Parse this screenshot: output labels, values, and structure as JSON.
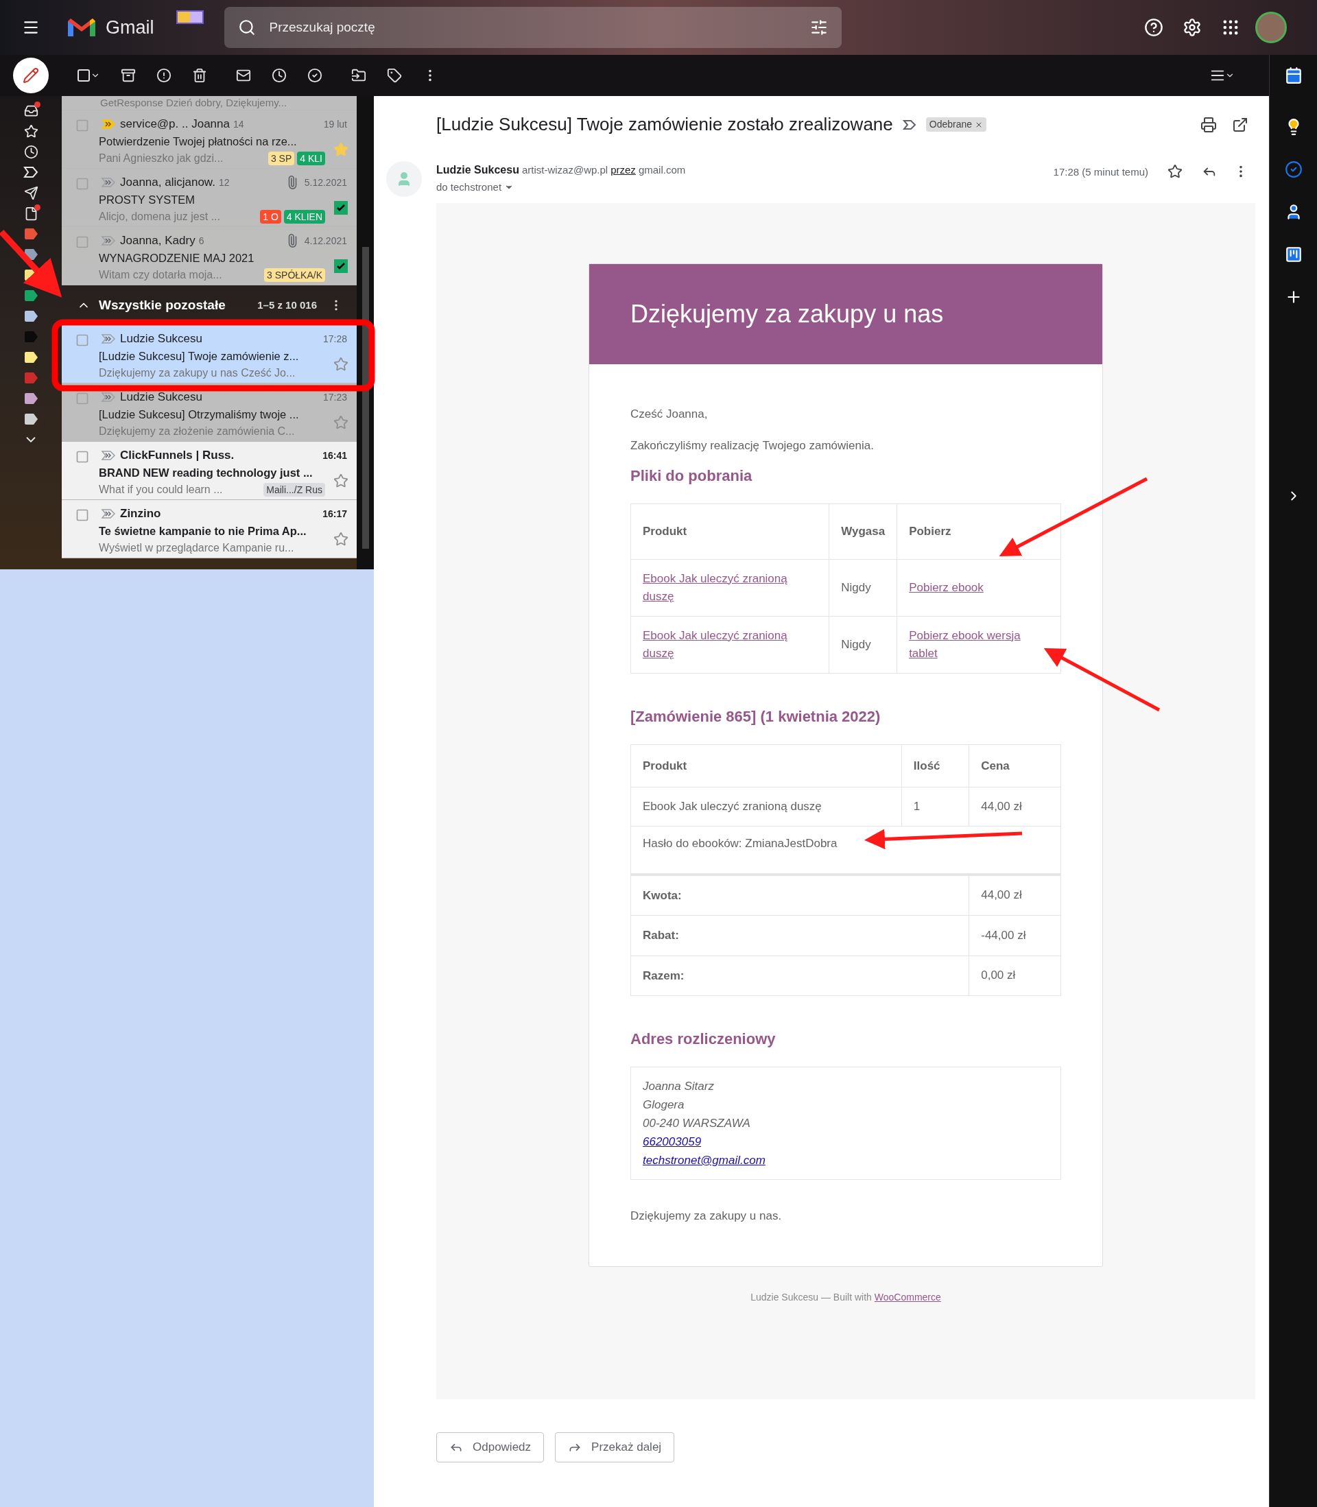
{
  "top_bar": {
    "app_name": "Gmail",
    "search": {
      "placeholder": "Przeszukaj pocztę"
    }
  },
  "toolbar": {
    "select_all": {
      "checked": false
    }
  },
  "nav": {
    "badged": [
      {
        "dot": true
      },
      {
        "dot": false
      },
      {
        "dot": false
      },
      {
        "dot": false
      },
      {
        "dot": false
      },
      {
        "dot": true
      }
    ],
    "labels": [
      {
        "color": "#e8533a"
      },
      {
        "color": "#8e9fb5"
      },
      {
        "color": "#f6e27c"
      },
      {
        "color": "#16a765"
      },
      {
        "color": "#b3c6e7"
      },
      {
        "color": "#0b0b0b"
      },
      {
        "color": "#fbe983"
      },
      {
        "color": "#cc2b2b"
      },
      {
        "color": "#c9a3c9"
      },
      {
        "color": "#d0d0d0"
      }
    ]
  },
  "email_list": {
    "top_snippet": "GetResponse Dzień dobry, Dziękujemy...",
    "rows": [
      {
        "sender": "service@p. .. Joanna",
        "count": "14",
        "date": "19 lut",
        "subject": "Potwierdzenie Twojej płatności na rze...",
        "snippet": "Pani Agnieszko jak gdzi...",
        "tags": [
          {
            "text": "3 SP",
            "color": "#fde293"
          },
          {
            "text": "4 KLI",
            "color": "#16a765"
          }
        ],
        "important": true,
        "attachment": false,
        "kind": "star",
        "starred": true,
        "unread": false,
        "selected": false
      },
      {
        "sender": "Joanna, alicjanow.",
        "count": "12",
        "date": "5.12.2021",
        "subject": "PROSTY SYSTEM",
        "snippet": "Alicjo, domena juz jest ...",
        "tags": [
          {
            "text": "1 O",
            "color": "#fb4c2f"
          },
          {
            "text": "4 KLIEN",
            "color": "#16a765"
          }
        ],
        "important": false,
        "attachment": true,
        "kind": "check",
        "starred": true,
        "unread": false,
        "selected": false
      },
      {
        "sender": "Joanna, Kadry",
        "count": "6",
        "date": "4.12.2021",
        "subject": "WYNAGRODZENIE MAJ 2021",
        "snippet": "Witam czy dotarła moja...",
        "tags": [
          {
            "text": "3 SPÓŁKA/K",
            "color": "#fde293"
          }
        ],
        "important": false,
        "attachment": true,
        "kind": "check",
        "starred": true,
        "unread": false,
        "selected": false
      }
    ],
    "section": {
      "title": "Wszystkie pozostałe",
      "range": "1–5 z 10 016",
      "expanded": true
    },
    "section_rows": [
      {
        "sender": "Ludzie Sukcesu",
        "date": "17:28",
        "subject": "[Ludzie Sukcesu] Twoje zamówienie z...",
        "snippet": "Dziękujemy za zakupy u nas Cześć Jo...",
        "tags": [],
        "important": false,
        "attachment": false,
        "kind": "star",
        "starred": false,
        "unread": false,
        "selected": true
      },
      {
        "sender": "Ludzie Sukcesu",
        "date": "17:23",
        "subject": "[Ludzie Sukcesu] Otrzymaliśmy twoje ...",
        "snippet": "Dziękujemy za złożenie zamówienia C...",
        "tags": [],
        "important": false,
        "attachment": false,
        "kind": "star",
        "starred": false,
        "unread": false,
        "selected": false
      },
      {
        "sender": "ClickFunnels | Russ.",
        "date": "16:41",
        "subject": "BRAND NEW reading technology just ...",
        "snippet": "What if you could learn ...",
        "tags": [
          {
            "text": "Maili.../Z Rus",
            "color": "#dadce0"
          }
        ],
        "important": false,
        "attachment": false,
        "kind": "star",
        "starred": false,
        "unread": true,
        "selected": false
      },
      {
        "sender": "Zinzino",
        "date": "16:17",
        "subject": "Te świetne kampanie to nie Prima Ap...",
        "snippet": "Wyświetl w przeglądarce Kampanie ru...",
        "tags": [],
        "important": false,
        "attachment": false,
        "kind": "star",
        "starred": false,
        "unread": true,
        "selected": false
      }
    ]
  },
  "message": {
    "subject": "[Ludzie Sukcesu] Twoje zamówienie zostało zrealizowane",
    "label": "Odebrane",
    "sender_name": "Ludzie Sukcesu",
    "sender_email": "artist-wizaz@wp.pl",
    "via_link": "przez",
    "via": "gmail.com",
    "to": "do techstronet",
    "time": "17:28 (5 minut temu)",
    "body": {
      "banner": "Dziękujemy za zakupy u nas",
      "greeting": "Cześć Joanna,",
      "intro": "Zakończyliśmy realizację Twojego zamówienia.",
      "downloads": {
        "heading": "Pliki do pobrania",
        "columns": [
          "Produkt",
          "Wygasa",
          "Pobierz"
        ],
        "rows": [
          {
            "product": "Ebook Jak uleczyć zranioną duszę",
            "expires": "Nigdy",
            "download": "Pobierz ebook"
          },
          {
            "product": "Ebook Jak uleczyć zranioną duszę",
            "expires": "Nigdy",
            "download": "Pobierz ebook wersja tablet"
          }
        ]
      },
      "order": {
        "heading": "[Zamówienie 865] (1 kwietnia 2022)",
        "columns": [
          "Produkt",
          "Ilość",
          "Cena"
        ],
        "rows": [
          {
            "product": "Ebook Jak uleczyć zranioną duszę",
            "quantity": "1",
            "price": "44,00 zł"
          }
        ],
        "note": "Hasło do ebooków: ZmianaJestDobra",
        "totals": [
          {
            "label": "Kwota:",
            "value": "44,00 zł"
          },
          {
            "label": "Rabat:",
            "value": "-44,00 zł"
          },
          {
            "label": "Razem:",
            "value": "0,00 zł"
          }
        ]
      },
      "billing": {
        "heading": "Adres rozliczeniowy",
        "lines": [
          "Joanna Sitarz",
          "Glogera",
          "00-240 WARSZAWA"
        ],
        "phone": "662003059",
        "email": "techstronet@gmail.com"
      },
      "closing": "Dziękujemy za zakupy u nas.",
      "footer": {
        "text": "Ludzie Sukcesu — Built with",
        "link": "WooCommerce"
      }
    },
    "actions": [
      {
        "kind": "reply",
        "label": "Odpowiedz"
      },
      {
        "kind": "forward",
        "label": "Przekaż dalej"
      }
    ]
  }
}
